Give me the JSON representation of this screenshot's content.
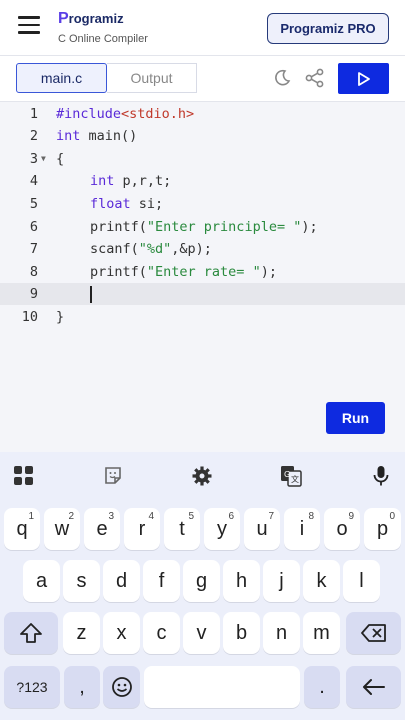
{
  "header": {
    "logo_text": "rogramiz",
    "logo_mark": "P",
    "subtitle": "C Online Compiler",
    "pro_button": "Programiz PRO"
  },
  "toolbar": {
    "tab_file": "main.c",
    "tab_output": "Output"
  },
  "editor": {
    "line_numbers": [
      "1",
      "2",
      "3",
      "4",
      "5",
      "6",
      "7",
      "8",
      "9",
      "10"
    ],
    "line1": {
      "a": "#include",
      "b": "<stdio.h>"
    },
    "line2": {
      "a": "int",
      "b": " main()"
    },
    "line3": "{",
    "line4": {
      "a": "int",
      "b": " p,r,t;"
    },
    "line5": {
      "a": "float",
      "b": " si;"
    },
    "line6": {
      "a": "printf(",
      "b": "\"Enter principle= \"",
      "c": ");"
    },
    "line7": {
      "a": "scanf(",
      "b": "\"%d\"",
      "c": ",&p);"
    },
    "line8": {
      "a": "printf(",
      "b": "\"Enter rate= \"",
      "c": ");"
    },
    "line10": "}",
    "run_label": "Run"
  },
  "keyboard": {
    "row1": [
      {
        "k": "q",
        "h": "1"
      },
      {
        "k": "w",
        "h": "2"
      },
      {
        "k": "e",
        "h": "3"
      },
      {
        "k": "r",
        "h": "4"
      },
      {
        "k": "t",
        "h": "5"
      },
      {
        "k": "y",
        "h": "6"
      },
      {
        "k": "u",
        "h": "7"
      },
      {
        "k": "i",
        "h": "8"
      },
      {
        "k": "o",
        "h": "9"
      },
      {
        "k": "p",
        "h": "0"
      }
    ],
    "row2": [
      "a",
      "s",
      "d",
      "f",
      "g",
      "h",
      "j",
      "k",
      "l"
    ],
    "row3": [
      "z",
      "x",
      "c",
      "v",
      "b",
      "n",
      "m"
    ],
    "sym_label": "?123",
    "comma": ",",
    "period": "."
  },
  "colors": {
    "accent": "#0e2ae0",
    "keyword": "#5a2ad8",
    "string": "#2a8a3e"
  }
}
